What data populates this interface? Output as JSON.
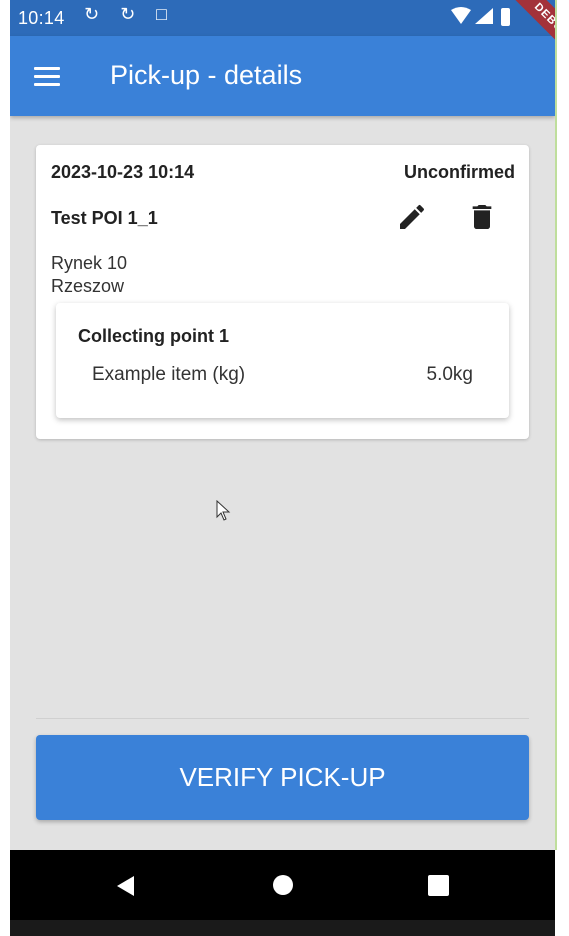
{
  "status_bar": {
    "time": "10:14",
    "left_icons": "↻ ↻ □"
  },
  "app_bar": {
    "title": "Pick-up - details"
  },
  "debug_ribbon": "DEBUG",
  "pickup": {
    "date": "2023-10-23 10:14",
    "status": "Unconfirmed",
    "poi_name": "Test POI 1_1",
    "address_line1": "Rynek 10",
    "address_line2": "Rzeszow",
    "collecting_point": {
      "title": "Collecting point 1",
      "item_name": "Example item (kg)",
      "item_weight": "5.0kg"
    }
  },
  "actions": {
    "verify_label": "VERIFY PICK-UP"
  },
  "colors": {
    "status_bar": "#2d6bb9",
    "app_bar": "#3a81d8",
    "background": "#e2e2e2",
    "debug_ribbon": "#a3323a"
  }
}
